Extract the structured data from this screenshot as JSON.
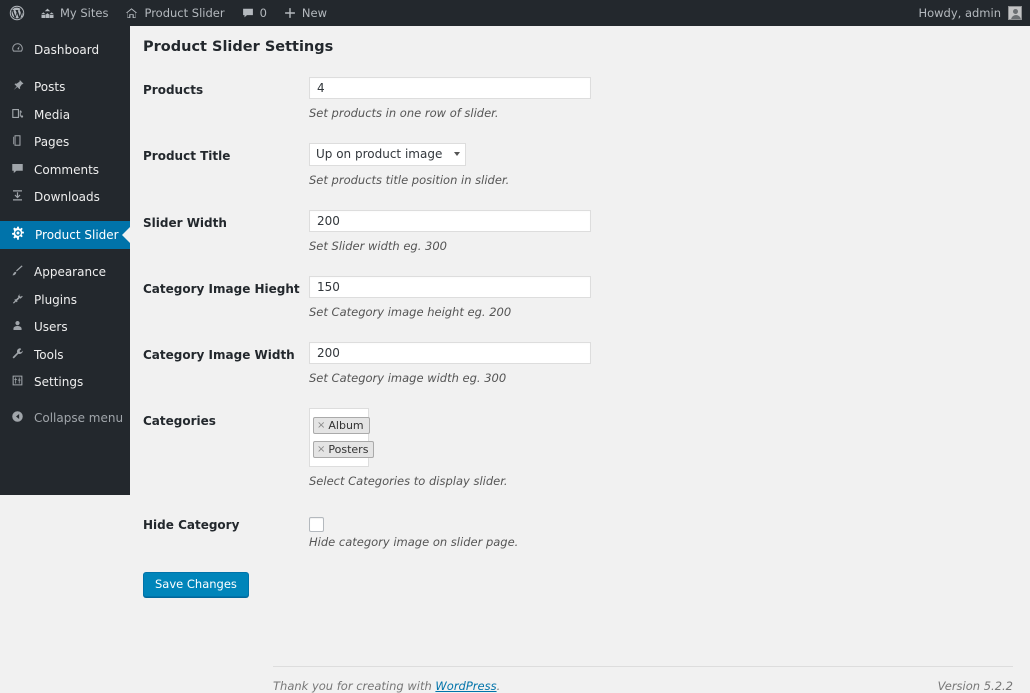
{
  "adminbar": {
    "logo_icon": "wordpress-icon",
    "items": [
      {
        "label": "My Sites",
        "icon": "sites-icon"
      },
      {
        "label": "Product Slider",
        "icon": "home-icon"
      },
      {
        "label": "0",
        "icon": "comment-bubble-icon"
      },
      {
        "label": "New",
        "icon": "plus-icon"
      }
    ],
    "howdy": "Howdy, admin",
    "avatar_icon": "user-avatar-icon"
  },
  "sidebar": {
    "items": [
      {
        "label": "Dashboard",
        "icon": "dashboard-icon",
        "current": false
      },
      {
        "label": "Posts",
        "icon": "pin-icon",
        "current": false
      },
      {
        "label": "Media",
        "icon": "media-icon",
        "current": false
      },
      {
        "label": "Pages",
        "icon": "pages-icon",
        "current": false
      },
      {
        "label": "Comments",
        "icon": "comment-icon",
        "current": false
      },
      {
        "label": "Downloads",
        "icon": "download-icon",
        "current": false
      },
      {
        "label": "Product Slider",
        "icon": "gear-icon",
        "current": true
      },
      {
        "label": "Appearance",
        "icon": "paintbrush-icon",
        "current": false
      },
      {
        "label": "Plugins",
        "icon": "plug-icon",
        "current": false
      },
      {
        "label": "Users",
        "icon": "user-icon",
        "current": false
      },
      {
        "label": "Tools",
        "icon": "wrench-icon",
        "current": false
      },
      {
        "label": "Settings",
        "icon": "sliders-icon",
        "current": false
      }
    ],
    "collapse": {
      "label": "Collapse menu",
      "icon": "collapse-arrow-icon"
    }
  },
  "main": {
    "page_title": "Product Slider Settings",
    "fields": {
      "products": {
        "label": "Products",
        "value": "4",
        "description": "Set products in one row of slider."
      },
      "product_title": {
        "label": "Product Title",
        "value": "Up on product image",
        "description": "Set products title position in slider."
      },
      "slider_width": {
        "label": "Slider Width",
        "value": "200",
        "description": "Set Slider width eg. 300"
      },
      "category_image_height": {
        "label": "Category Image Hieght",
        "value": "150",
        "description": "Set Category image height eg. 200"
      },
      "category_image_width": {
        "label": "Category Image Width",
        "value": "200",
        "description": "Set Category image width eg. 300"
      },
      "categories": {
        "label": "Categories",
        "selected": [
          {
            "remove": "×",
            "name": "Album"
          },
          {
            "remove": "×",
            "name": "Posters"
          }
        ],
        "description": "Select Categories to display slider."
      },
      "hide_category": {
        "label": "Hide Category",
        "checked": false,
        "description": "Hide category image on slider page."
      }
    },
    "save_button": "Save Changes"
  },
  "footer": {
    "thanks_prefix": "Thank you for creating with ",
    "link": "WordPress",
    "thanks_suffix": ".",
    "version": "Version 5.2.2"
  },
  "colors": {
    "admin_dark": "#23282d",
    "accent_blue": "#0073aa",
    "button_blue": "#0085ba",
    "page_bg": "#f1f1f1"
  }
}
